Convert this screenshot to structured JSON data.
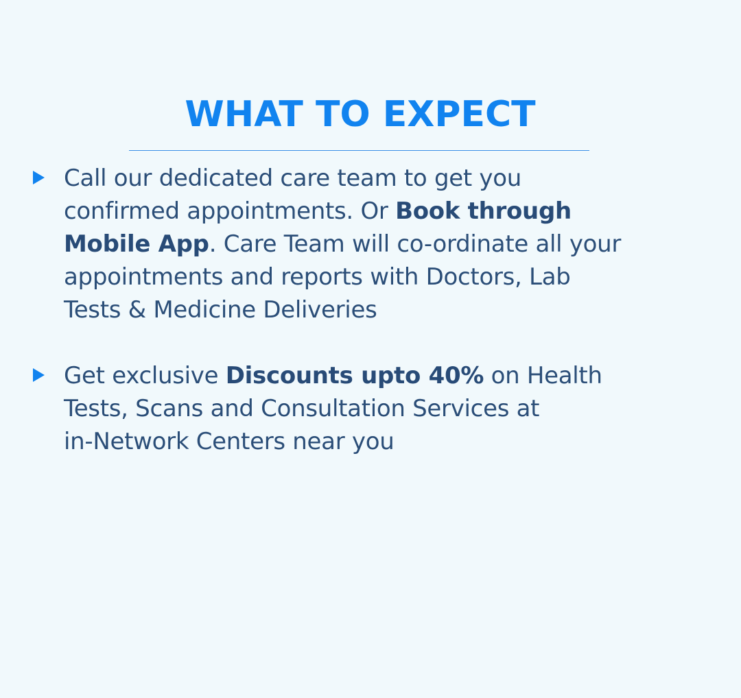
{
  "title": "WHAT TO EXPECT",
  "colors": {
    "background": "#f1f9fc",
    "accent": "#1183ef",
    "text": "#2b4e78"
  },
  "bullets": [
    {
      "icon": "triangle-right-icon",
      "lines": [
        {
          "parts": [
            "Call our dedicated care team to get you"
          ]
        },
        {
          "parts": [
            "confirmed appointments. Or ",
            "Book through"
          ]
        },
        {
          "parts": [
            "Mobile App",
            ". Care Team will co-ordinate all your"
          ]
        },
        {
          "parts": [
            "appointments and reports with Doctors, Lab"
          ]
        },
        {
          "parts": [
            "Tests & Medicine Deliveries"
          ]
        }
      ]
    },
    {
      "icon": "triangle-right-icon",
      "lines": [
        {
          "parts": [
            "Get exclusive ",
            "Discounts upto 40%",
            " on Health"
          ]
        },
        {
          "parts": [
            "Tests, Scans and Consultation Services at"
          ]
        },
        {
          "parts": [
            "in-Network Centers near you"
          ]
        }
      ]
    }
  ]
}
